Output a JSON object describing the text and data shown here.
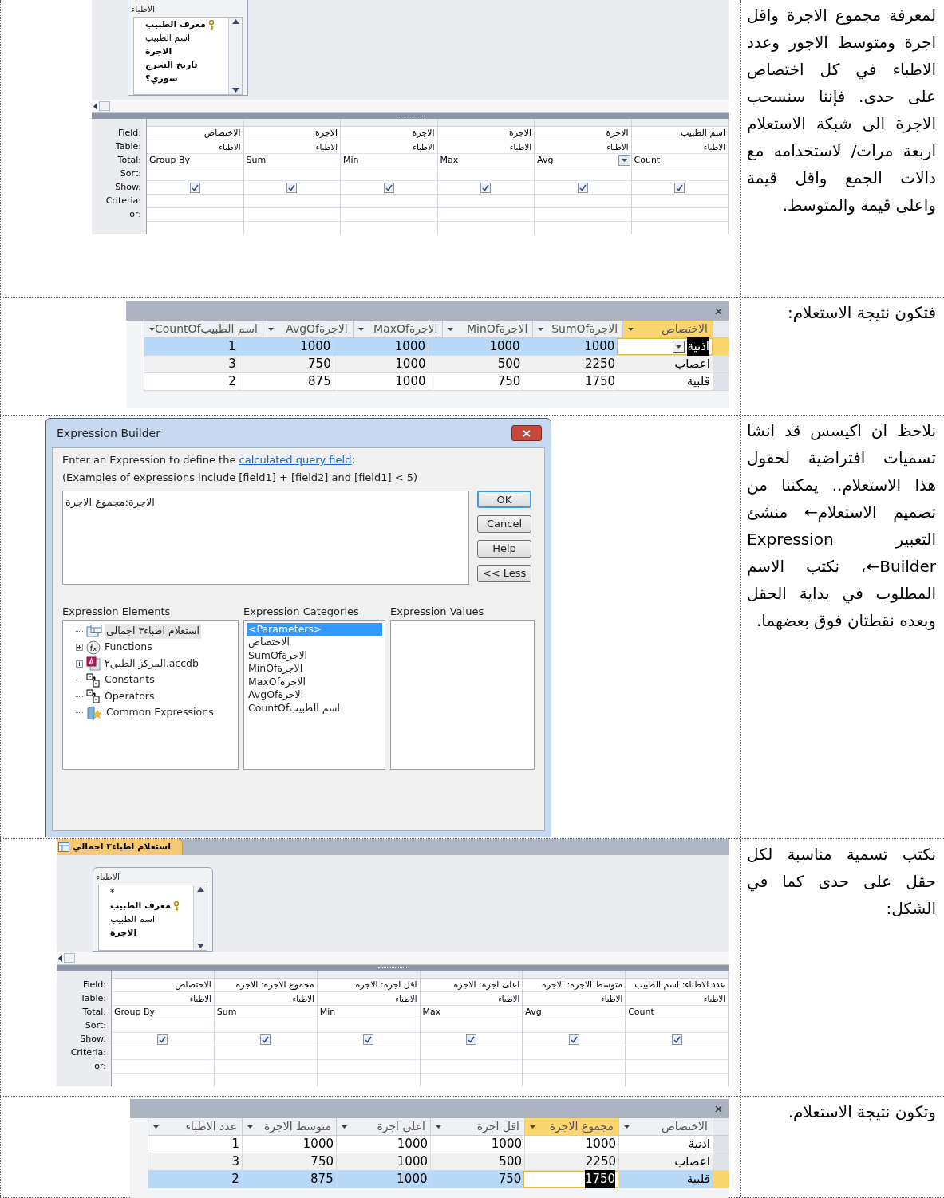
{
  "sections": [
    {
      "kind": "design",
      "text": "لمعرفة مجموع الاجرة واقل اجرة ومتوسط الاجور وعدد الاطباء في كل اختصاص على حدى. فإننا سنسحب الاجرة الى شبكة الاستعلام اربعة مرات/ لاستخدامه مع دالات الجمع واقل قيمة واعلى قيمة والمتوسط.",
      "field_list": {
        "title": "الاطباء",
        "items": [
          {
            "text": "معرف الطبيب",
            "key": true,
            "bold": true
          },
          {
            "text": "اسم الطبيب",
            "key": false,
            "bold": false
          },
          {
            "text": "الاجرة",
            "key": false,
            "bold": true
          },
          {
            "text": "تاريخ التخرج",
            "key": false,
            "bold": true
          },
          {
            "text": "سوري؟",
            "key": false,
            "bold": true
          }
        ]
      },
      "grid": {
        "labels": [
          "Field:",
          "Table:",
          "Total:",
          "Sort:",
          "Show:",
          "Criteria:",
          "or:"
        ],
        "columns": [
          {
            "field": "اسم الطبيب",
            "table": "الاطباء",
            "total": "Count",
            "show": true,
            "dropdown": false
          },
          {
            "field": "الاجرة",
            "table": "الاطباء",
            "total": "Avg",
            "show": true,
            "dropdown": true
          },
          {
            "field": "الاجرة",
            "table": "الاطباء",
            "total": "Max",
            "show": true,
            "dropdown": false
          },
          {
            "field": "الاجرة",
            "table": "الاطباء",
            "total": "Min",
            "show": true,
            "dropdown": false
          },
          {
            "field": "الاجرة",
            "table": "الاطباء",
            "total": "Sum",
            "show": true,
            "dropdown": false
          },
          {
            "field": "الاختصاص",
            "table": "الاطباء",
            "total": "Group By",
            "show": true,
            "dropdown": false
          }
        ]
      }
    },
    {
      "kind": "datasheet",
      "text": "فتكون نتيجة الاستعلام:",
      "combo_in_active_cell": true,
      "columns": [
        {
          "label": "الاختصاص",
          "highlighted": true
        },
        {
          "label": "SumOfالاجرة",
          "highlighted": false
        },
        {
          "label": "MinOfالاجرة",
          "highlighted": false
        },
        {
          "label": "MaxOfالاجرة",
          "highlighted": false
        },
        {
          "label": "AvgOfالاجرة",
          "highlighted": false
        },
        {
          "label": "CountOfاسم الطبيب",
          "highlighted": false
        }
      ],
      "rows": [
        {
          "selected": true,
          "cells": [
            {
              "text": "اذنية",
              "highlighted": true
            },
            {
              "text": "1000",
              "highlighted": false
            },
            {
              "text": "1000",
              "highlighted": false
            },
            {
              "text": "1000",
              "highlighted": false
            },
            {
              "text": "1000",
              "highlighted": false
            },
            {
              "text": "1",
              "highlighted": false
            }
          ]
        },
        {
          "selected": false,
          "cells": [
            {
              "text": "اعصاب",
              "highlighted": false
            },
            {
              "text": "2250",
              "highlighted": false
            },
            {
              "text": "500",
              "highlighted": false
            },
            {
              "text": "1000",
              "highlighted": false
            },
            {
              "text": "750",
              "highlighted": false
            },
            {
              "text": "3",
              "highlighted": false
            }
          ]
        },
        {
          "selected": false,
          "cells": [
            {
              "text": "قلبية",
              "highlighted": false
            },
            {
              "text": "1750",
              "highlighted": false
            },
            {
              "text": "750",
              "highlighted": false
            },
            {
              "text": "1000",
              "highlighted": false
            },
            {
              "text": "875",
              "highlighted": false
            },
            {
              "text": "2",
              "highlighted": false
            }
          ]
        }
      ]
    },
    {
      "kind": "builder",
      "text": "نلاحظ ان اكيسس قد انشا تسميات افتراضية لحقول هذا الاستعلام.. يمكننا من تصميم الاستعلام← منشئ التعبير Expression Builder←، نكتب الاسم المطلوب في بداية الحقل وبعده نقطتان فوق بعضهما.",
      "dialog": {
        "title": "Expression Builder",
        "intro": {
          "before": "Enter an Expression to define the ",
          "link": "calculated query field",
          "after": ":"
        },
        "examples": "(Examples of expressions include [field1] + [field2] and [field1] < 5)",
        "expression": "الاجرة:مجموع الاجرة",
        "buttons": [
          {
            "label": "OK",
            "default": true
          },
          {
            "label": "Cancel",
            "default": false
          },
          {
            "label": "Help",
            "default": false
          },
          {
            "label": "<< Less",
            "default": false
          }
        ],
        "elements": {
          "label": "Expression Elements",
          "items": [
            {
              "text": "استعلام اطباء٣ اجمالي",
              "kind": "query",
              "expandable": false,
              "selected": true
            },
            {
              "text": "Functions",
              "kind": "function",
              "expandable": true,
              "selected": false
            },
            {
              "text": "المركز الطبي٢.accdb",
              "kind": "database",
              "expandable": true,
              "selected": false
            },
            {
              "text": "Constants",
              "kind": "folder",
              "expandable": false,
              "selected": false
            },
            {
              "text": "Operators",
              "kind": "folder",
              "expandable": false,
              "selected": false
            },
            {
              "text": "Common Expressions",
              "kind": "star",
              "expandable": false,
              "selected": false
            }
          ]
        },
        "categories": {
          "label": "Expression Categories",
          "items": [
            {
              "text": "<Parameters>",
              "selected": true
            },
            {
              "text": "الاختصاص",
              "selected": false
            },
            {
              "text": "SumOfالاجرة",
              "selected": false
            },
            {
              "text": "MinOfالاجرة",
              "selected": false
            },
            {
              "text": "MaxOfالاجرة",
              "selected": false
            },
            {
              "text": "AvgOfالاجرة",
              "selected": false
            },
            {
              "text": "CountOfاسم الطبيب",
              "selected": false
            }
          ]
        },
        "values": {
          "label": "Expression Values"
        }
      }
    },
    {
      "kind": "design",
      "text": "نكتب تسمية مناسبة لكل حقل على حدى كما في الشكل:",
      "tab": "استعلام اطباء٣ اجمالي",
      "field_list": {
        "title": "الاطباء",
        "items": [
          {
            "text": "*",
            "key": false,
            "bold": false
          },
          {
            "text": "معرف الطبيب",
            "key": true,
            "bold": true
          },
          {
            "text": "اسم الطبيب",
            "key": false,
            "bold": false
          },
          {
            "text": "الاجرة",
            "key": false,
            "bold": true
          }
        ]
      },
      "grid": {
        "labels": [
          "Field:",
          "Table:",
          "Total:",
          "Sort:",
          "Show:",
          "Criteria:",
          "or:"
        ],
        "columns": [
          {
            "field": "عدد الاطباء: اسم الطبيب",
            "table": "الاطباء",
            "total": "Count",
            "show": true,
            "dropdown": false
          },
          {
            "field": "متوسط الاجرة: الاجرة",
            "table": "الاطباء",
            "total": "Avg",
            "show": true,
            "dropdown": false
          },
          {
            "field": "اعلى اجرة: الاجرة",
            "table": "الاطباء",
            "total": "Max",
            "show": true,
            "dropdown": false
          },
          {
            "field": "اقل اجرة: الاجرة",
            "table": "الاطباء",
            "total": "Min",
            "show": true,
            "dropdown": false
          },
          {
            "field": "مجموع الاجرة: الاجرة",
            "table": "الاطباء",
            "total": "Sum",
            "show": true,
            "dropdown": false
          },
          {
            "field": "الاختصاص",
            "table": "الاطباء",
            "total": "Group By",
            "show": true,
            "dropdown": false
          }
        ]
      }
    },
    {
      "kind": "datasheet",
      "text": "وتكون نتيجة الاستعلام.",
      "combo_in_active_cell": false,
      "columns": [
        {
          "label": "الاختصاص",
          "highlighted": false
        },
        {
          "label": "مجموع الاجرة",
          "highlighted": true
        },
        {
          "label": "اقل اجرة",
          "highlighted": false
        },
        {
          "label": "اعلى اجرة",
          "highlighted": false
        },
        {
          "label": "متوسط الاجرة",
          "highlighted": false
        },
        {
          "label": "عدد الاطباء",
          "highlighted": false
        }
      ],
      "rows": [
        {
          "selected": false,
          "cells": [
            {
              "text": "اذنية",
              "highlighted": false
            },
            {
              "text": "1000",
              "highlighted": false
            },
            {
              "text": "1000",
              "highlighted": false
            },
            {
              "text": "1000",
              "highlighted": false
            },
            {
              "text": "1000",
              "highlighted": false
            },
            {
              "text": "1",
              "highlighted": false
            }
          ]
        },
        {
          "selected": false,
          "cells": [
            {
              "text": "اعصاب",
              "highlighted": false
            },
            {
              "text": "2250",
              "highlighted": false
            },
            {
              "text": "500",
              "highlighted": false
            },
            {
              "text": "1000",
              "highlighted": false
            },
            {
              "text": "750",
              "highlighted": false
            },
            {
              "text": "3",
              "highlighted": false
            }
          ]
        },
        {
          "selected": true,
          "cells": [
            {
              "text": "قلبية",
              "highlighted": false
            },
            {
              "text": "1750",
              "highlighted": true
            },
            {
              "text": "750",
              "highlighted": false
            },
            {
              "text": "1000",
              "highlighted": false
            },
            {
              "text": "875",
              "highlighted": false
            },
            {
              "text": "2",
              "highlighted": false
            }
          ]
        }
      ]
    }
  ]
}
